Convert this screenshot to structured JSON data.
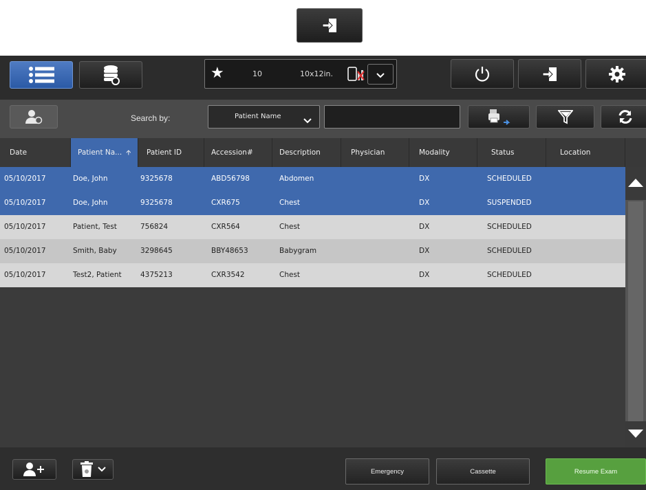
{
  "top_button": {
    "icon": "exit-door-icon"
  },
  "toolbar": {
    "list_icon": "list-icon",
    "database_icon": "database-stack-icon",
    "preset": {
      "star": "★",
      "count": "10",
      "size": "10x12in.",
      "plate_icon": "detector-plate-icon"
    },
    "power_icon": "power-icon",
    "logout_icon": "exit-door-icon",
    "settings_icon": "gear-icon"
  },
  "search": {
    "label": "Search by:",
    "field": "Patient Name",
    "value": "",
    "user_info_icon": "user-info-icon",
    "export_icon": "export-icon",
    "filter_icon": "filter-icon",
    "refresh_icon": "refresh-icon"
  },
  "table": {
    "columns": [
      "Date",
      "Patient Na...",
      "Patient ID",
      "Accession#",
      "Description",
      "Physician",
      "Modality",
      "Status",
      "Location"
    ],
    "sort_arrow": "🡩",
    "rows": [
      {
        "date": "05/10/2017",
        "name": "Doe, John",
        "id": "9325678",
        "accession": "ABD56798",
        "description": "Abdomen",
        "physician": "",
        "modality": "DX",
        "status": "SCHEDULED",
        "location": ""
      },
      {
        "date": "05/10/2017",
        "name": "Doe, John",
        "id": "9325678",
        "accession": "CXR675",
        "description": "Chest",
        "physician": "",
        "modality": "DX",
        "status": "SUSPENDED",
        "location": ""
      },
      {
        "date": "05/10/2017",
        "name": "Patient, Test",
        "id": "756824",
        "accession": "CXR564",
        "description": "Chest",
        "physician": "",
        "modality": "DX",
        "status": "SCHEDULED",
        "location": ""
      },
      {
        "date": "05/10/2017",
        "name": "Smith, Baby",
        "id": "3298645",
        "accession": "BBY48653",
        "description": "Babygram",
        "physician": "",
        "modality": "DX",
        "status": "SCHEDULED",
        "location": ""
      },
      {
        "date": "05/10/2017",
        "name": "Test2, Patient",
        "id": "4375213",
        "accession": "CXR3542",
        "description": "Chest",
        "physician": "",
        "modality": "DX",
        "status": "SCHEDULED",
        "location": ""
      }
    ]
  },
  "footer": {
    "add_patient_icon": "add-patient-icon",
    "delete_icon": "trash-icon",
    "emergency": "Emergency",
    "cassette": "Cassette",
    "resume": "Resume Exam"
  }
}
